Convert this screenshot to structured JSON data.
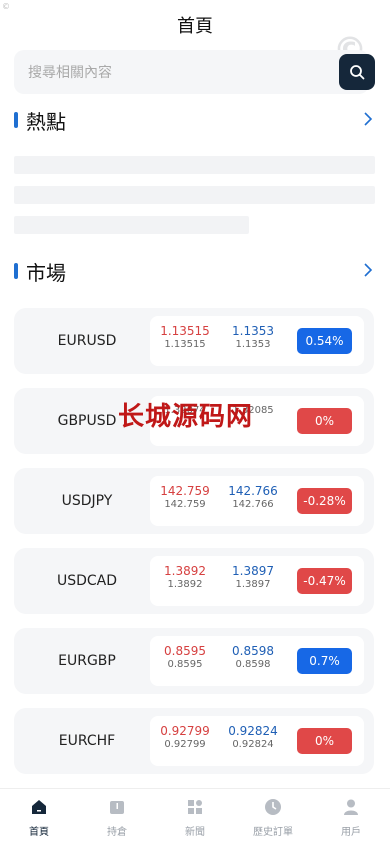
{
  "header": {
    "title": "首頁"
  },
  "search": {
    "placeholder": "搜尋相關內容"
  },
  "hot": {
    "title": "熱點"
  },
  "market": {
    "title": "市場"
  },
  "watermark": {
    "text": "长城源码网"
  },
  "corner_mark": "©",
  "big_mark": "©",
  "markets": [
    {
      "symbol": "EURUSD",
      "bid": "1.13515",
      "bid_sub": "1.13515",
      "ask": "1.1353",
      "ask_sub": "1.1353",
      "change": "0.54%",
      "dir": "up"
    },
    {
      "symbol": "GBPUSD",
      "bid": "",
      "bid_sub": "1.32074",
      "ask": "",
      "ask_sub": "1.32085",
      "change": "0%",
      "dir": "down"
    },
    {
      "symbol": "USDJPY",
      "bid": "142.759",
      "bid_sub": "142.759",
      "ask": "142.766",
      "ask_sub": "142.766",
      "change": "-0.28%",
      "dir": "down"
    },
    {
      "symbol": "USDCAD",
      "bid": "1.3892",
      "bid_sub": "1.3892",
      "ask": "1.3897",
      "ask_sub": "1.3897",
      "change": "-0.47%",
      "dir": "down"
    },
    {
      "symbol": "EURGBP",
      "bid": "0.8595",
      "bid_sub": "0.8595",
      "ask": "0.8598",
      "ask_sub": "0.8598",
      "change": "0.7%",
      "dir": "up"
    },
    {
      "symbol": "EURCHF",
      "bid": "0.92799",
      "bid_sub": "0.92799",
      "ask": "0.92824",
      "ask_sub": "0.92824",
      "change": "0%",
      "dir": "down"
    }
  ],
  "tabs": [
    {
      "label": "首頁",
      "icon": "home-icon",
      "active": true
    },
    {
      "label": "持倉",
      "icon": "book-icon",
      "active": false
    },
    {
      "label": "新聞",
      "icon": "grid-icon",
      "active": false
    },
    {
      "label": "歷史訂單",
      "icon": "clock-icon",
      "active": false
    },
    {
      "label": "用戶",
      "icon": "user-icon",
      "active": false
    }
  ],
  "colors": {
    "accent": "#1f6fd1",
    "up": "#1768e6",
    "down": "#e04848",
    "bid": "#d64040",
    "ask": "#1f5fb5",
    "dark": "#15273a"
  }
}
